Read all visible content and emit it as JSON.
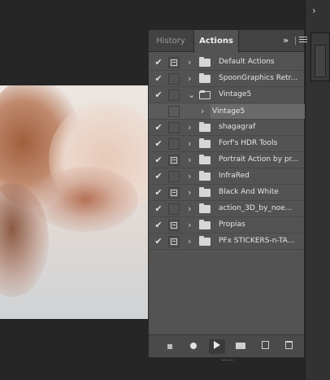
{
  "panel": {
    "tabs": [
      {
        "label": "History",
        "active": false
      },
      {
        "label": "Actions",
        "active": true
      }
    ],
    "collapse_glyph": "»",
    "menu_icon": "hamburger-icon"
  },
  "actions": [
    {
      "label": "Default Actions",
      "checked": true,
      "dialog": true,
      "expanded": false
    },
    {
      "label": "SpoonGraphics Retr...",
      "checked": true,
      "dialog": false,
      "expanded": false
    },
    {
      "label": "Vintage5",
      "checked": true,
      "dialog": false,
      "expanded": true
    },
    {
      "label": "Vintage5",
      "checked": false,
      "dialog": false,
      "child": true
    },
    {
      "label": "shagagraf",
      "checked": true,
      "dialog": false,
      "expanded": false
    },
    {
      "label": "Forf's HDR Tools",
      "checked": true,
      "dialog": false,
      "expanded": false
    },
    {
      "label": "Portrait Action by pr...",
      "checked": true,
      "dialog": true,
      "expanded": false
    },
    {
      "label": "InfraRed",
      "checked": true,
      "dialog": false,
      "expanded": false
    },
    {
      "label": "Black And White",
      "checked": true,
      "dialog": true,
      "expanded": false
    },
    {
      "label": "action_3D_by_noe...",
      "checked": true,
      "dialog": false,
      "expanded": false
    },
    {
      "label": "Propias",
      "checked": true,
      "dialog": true,
      "expanded": false
    },
    {
      "label": "PFx STICKERS-n-TA...",
      "checked": true,
      "dialog": true,
      "expanded": false
    }
  ],
  "footer": {
    "buttons": [
      "stop-icon",
      "record-icon",
      "play-icon",
      "folder-icon",
      "new-action-icon",
      "trash-icon"
    ],
    "active": "play-icon"
  },
  "glyphs": {
    "check": "✔",
    "chevron_right": "›",
    "chevron_down": "⌄"
  },
  "colors": {
    "panel_bg": "#535353",
    "tabbar_bg": "#424242",
    "app_bg": "#262626"
  }
}
